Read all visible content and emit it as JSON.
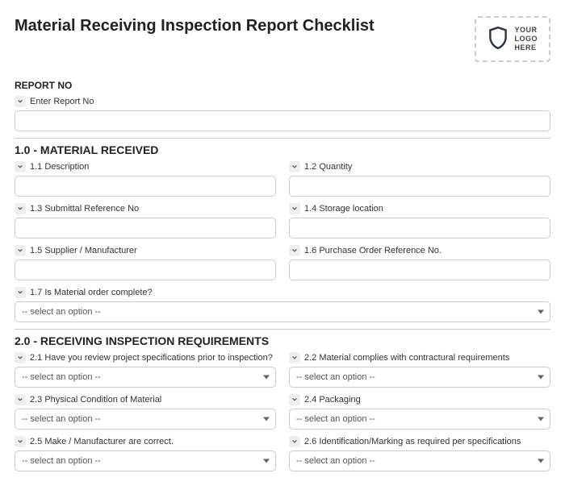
{
  "header": {
    "title": "Material Receiving Inspection Report Checklist",
    "logo_text": "YOUR\nLOGO\nHERE"
  },
  "report_no": {
    "heading": "REPORT NO",
    "field_label": "Enter Report No",
    "value": ""
  },
  "section1": {
    "heading": "1.0 - MATERIAL RECEIVED",
    "f1_1": {
      "label": "1.1 Description",
      "value": ""
    },
    "f1_2": {
      "label": "1.2 Quantity",
      "value": ""
    },
    "f1_3": {
      "label": "1.3 Submittal Reference No",
      "value": ""
    },
    "f1_4": {
      "label": "1.4 Storage location",
      "value": ""
    },
    "f1_5": {
      "label": "1.5 Supplier / Manufacturer",
      "value": ""
    },
    "f1_6": {
      "label": "1.6 Purchase Order Reference No.",
      "value": ""
    },
    "f1_7": {
      "label": "1.7 Is Material order complete?",
      "value": "-- select an option --"
    }
  },
  "section2": {
    "heading": "2.0 - RECEIVING INSPECTION REQUIREMENTS",
    "f2_1": {
      "label": "2.1 Have you review project specifications prior to inspection?",
      "value": "-- select an option --"
    },
    "f2_2": {
      "label": "2.2 Material complies with contractural requirements",
      "value": "-- select an option --"
    },
    "f2_3": {
      "label": "2.3 Physical Condition of Material",
      "value": "-- select an option --"
    },
    "f2_4": {
      "label": "2.4 Packaging",
      "value": "-- select an option --"
    },
    "f2_5": {
      "label": "2.5 Make / Manufacturer are correct.",
      "value": "-- select an option --"
    },
    "f2_6": {
      "label": "2.6 Identification/Marking as required per specifications",
      "value": "-- select an option --"
    }
  },
  "select_placeholder": "-- select an option --"
}
